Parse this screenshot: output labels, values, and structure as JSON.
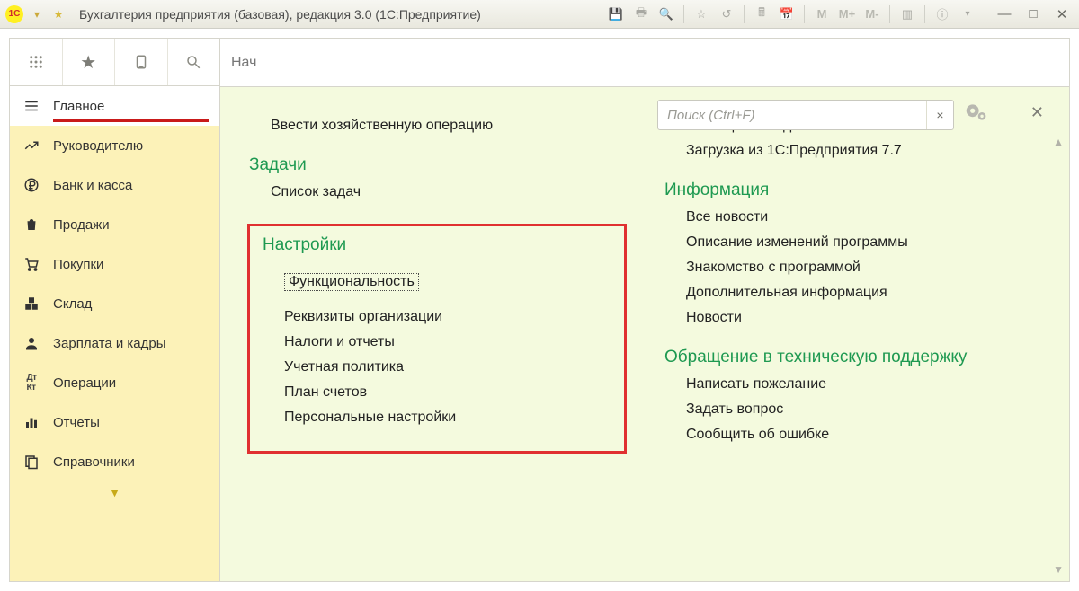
{
  "title": "Бухгалтерия предприятия (базовая), редакция 3.0  (1С:Предприятие)",
  "tabbar": {
    "label": "Нач"
  },
  "search": {
    "placeholder": "Поиск (Ctrl+F)"
  },
  "sidebar": {
    "items": [
      {
        "label": "Главное"
      },
      {
        "label": "Руководителю"
      },
      {
        "label": "Банк и касса"
      },
      {
        "label": "Продажи"
      },
      {
        "label": "Покупки"
      },
      {
        "label": "Склад"
      },
      {
        "label": "Зарплата и кадры"
      },
      {
        "label": "Операции"
      },
      {
        "label": "Отчеты"
      },
      {
        "label": "Справочники"
      }
    ]
  },
  "left_col": {
    "operations_item": "Ввести хозяйственную операцию",
    "tasks_h": "Задачи",
    "tasks_item": "Список задач",
    "settings_h": "Настройки",
    "settings_items": [
      "Функциональность",
      "Реквизиты организации",
      "Налоги и отчеты",
      "Учетная политика",
      "План счетов",
      "Персональные настройки"
    ]
  },
  "right_col": {
    "start_items": [
      "Помощник ввода остатков",
      "Загрузка из 1С:Предприятия 7.7"
    ],
    "info_h": "Информация",
    "info_items": [
      "Все новости",
      "Описание изменений программы",
      "Знакомство с программой",
      "Дополнительная информация",
      "Новости"
    ],
    "support_h": "Обращение в техническую поддержку",
    "support_items": [
      "Написать пожелание",
      "Задать вопрос",
      "Сообщить об ошибке"
    ]
  },
  "mem_buttons": {
    "m": "M",
    "mplus": "M+",
    "mminus": "M-"
  }
}
